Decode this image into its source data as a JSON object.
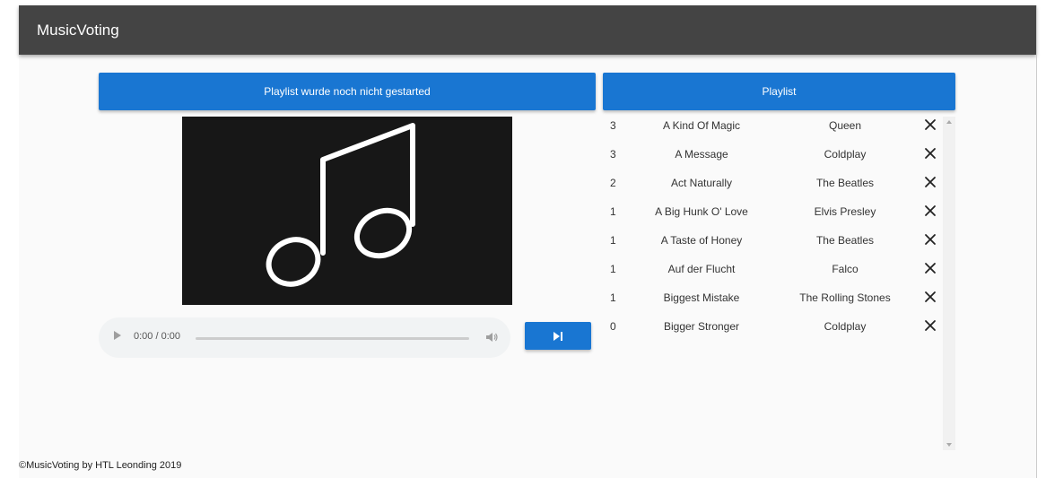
{
  "app": {
    "title": "MusicVoting"
  },
  "player": {
    "status_text": "Playlist wurde noch nicht gestarted",
    "time_display": "0:00 / 0:00",
    "art_icon": "music-note-icon",
    "skip_icon": "skip-next-icon"
  },
  "playlist": {
    "header": "Playlist",
    "rows": [
      {
        "votes": "3",
        "song": "A Kind Of Magic",
        "artist": "Queen"
      },
      {
        "votes": "3",
        "song": "A Message",
        "artist": "Coldplay"
      },
      {
        "votes": "2",
        "song": "Act Naturally",
        "artist": "The Beatles"
      },
      {
        "votes": "1",
        "song": "A Big Hunk O' Love",
        "artist": "Elvis Presley"
      },
      {
        "votes": "1",
        "song": "A Taste of Honey",
        "artist": "The Beatles"
      },
      {
        "votes": "1",
        "song": "Auf der Flucht",
        "artist": "Falco"
      },
      {
        "votes": "1",
        "song": "Biggest Mistake",
        "artist": "The Rolling Stones"
      },
      {
        "votes": "0",
        "song": "Bigger Stronger",
        "artist": "Coldplay"
      }
    ]
  },
  "footer": {
    "text": "©MusicVoting by HTL Leonding 2019"
  },
  "colors": {
    "toolbar": "#444444",
    "accent": "#1976d2",
    "art_bg": "#171717"
  }
}
